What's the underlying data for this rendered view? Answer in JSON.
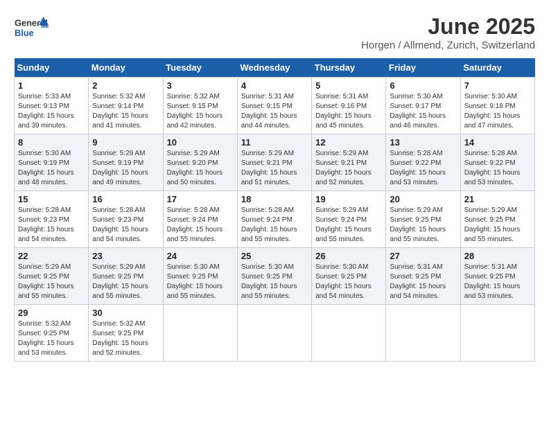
{
  "header": {
    "logo_general": "General",
    "logo_blue": "Blue",
    "title": "June 2025",
    "subtitle": "Horgen / Allmend, Zurich, Switzerland"
  },
  "calendar": {
    "days_of_week": [
      "Sunday",
      "Monday",
      "Tuesday",
      "Wednesday",
      "Thursday",
      "Friday",
      "Saturday"
    ],
    "weeks": [
      [
        null,
        null,
        null,
        null,
        null,
        null,
        null
      ]
    ],
    "cells": [
      [
        null,
        {
          "day": "2",
          "sunrise": "Sunrise: 5:32 AM",
          "sunset": "Sunset: 9:14 PM",
          "daylight": "Daylight: 15 hours and 41 minutes."
        },
        {
          "day": "3",
          "sunrise": "Sunrise: 5:32 AM",
          "sunset": "Sunset: 9:15 PM",
          "daylight": "Daylight: 15 hours and 42 minutes."
        },
        {
          "day": "4",
          "sunrise": "Sunrise: 5:31 AM",
          "sunset": "Sunset: 9:15 PM",
          "daylight": "Daylight: 15 hours and 44 minutes."
        },
        {
          "day": "5",
          "sunrise": "Sunrise: 5:31 AM",
          "sunset": "Sunset: 9:16 PM",
          "daylight": "Daylight: 15 hours and 45 minutes."
        },
        {
          "day": "6",
          "sunrise": "Sunrise: 5:30 AM",
          "sunset": "Sunset: 9:17 PM",
          "daylight": "Daylight: 15 hours and 46 minutes."
        },
        {
          "day": "7",
          "sunrise": "Sunrise: 5:30 AM",
          "sunset": "Sunset: 9:18 PM",
          "daylight": "Daylight: 15 hours and 47 minutes."
        }
      ],
      [
        {
          "day": "1",
          "sunrise": "Sunrise: 5:33 AM",
          "sunset": "Sunset: 9:13 PM",
          "daylight": "Daylight: 15 hours and 39 minutes."
        },
        null,
        null,
        null,
        null,
        null,
        null
      ],
      [
        {
          "day": "8",
          "sunrise": "Sunrise: 5:30 AM",
          "sunset": "Sunset: 9:19 PM",
          "daylight": "Daylight: 15 hours and 48 minutes."
        },
        {
          "day": "9",
          "sunrise": "Sunrise: 5:29 AM",
          "sunset": "Sunset: 9:19 PM",
          "daylight": "Daylight: 15 hours and 49 minutes."
        },
        {
          "day": "10",
          "sunrise": "Sunrise: 5:29 AM",
          "sunset": "Sunset: 9:20 PM",
          "daylight": "Daylight: 15 hours and 50 minutes."
        },
        {
          "day": "11",
          "sunrise": "Sunrise: 5:29 AM",
          "sunset": "Sunset: 9:21 PM",
          "daylight": "Daylight: 15 hours and 51 minutes."
        },
        {
          "day": "12",
          "sunrise": "Sunrise: 5:29 AM",
          "sunset": "Sunset: 9:21 PM",
          "daylight": "Daylight: 15 hours and 52 minutes."
        },
        {
          "day": "13",
          "sunrise": "Sunrise: 5:28 AM",
          "sunset": "Sunset: 9:22 PM",
          "daylight": "Daylight: 15 hours and 53 minutes."
        },
        {
          "day": "14",
          "sunrise": "Sunrise: 5:28 AM",
          "sunset": "Sunset: 9:22 PM",
          "daylight": "Daylight: 15 hours and 53 minutes."
        }
      ],
      [
        {
          "day": "15",
          "sunrise": "Sunrise: 5:28 AM",
          "sunset": "Sunset: 9:23 PM",
          "daylight": "Daylight: 15 hours and 54 minutes."
        },
        {
          "day": "16",
          "sunrise": "Sunrise: 5:28 AM",
          "sunset": "Sunset: 9:23 PM",
          "daylight": "Daylight: 15 hours and 54 minutes."
        },
        {
          "day": "17",
          "sunrise": "Sunrise: 5:28 AM",
          "sunset": "Sunset: 9:24 PM",
          "daylight": "Daylight: 15 hours and 55 minutes."
        },
        {
          "day": "18",
          "sunrise": "Sunrise: 5:28 AM",
          "sunset": "Sunset: 9:24 PM",
          "daylight": "Daylight: 15 hours and 55 minutes."
        },
        {
          "day": "19",
          "sunrise": "Sunrise: 5:29 AM",
          "sunset": "Sunset: 9:24 PM",
          "daylight": "Daylight: 15 hours and 55 minutes."
        },
        {
          "day": "20",
          "sunrise": "Sunrise: 5:29 AM",
          "sunset": "Sunset: 9:25 PM",
          "daylight": "Daylight: 15 hours and 55 minutes."
        },
        {
          "day": "21",
          "sunrise": "Sunrise: 5:29 AM",
          "sunset": "Sunset: 9:25 PM",
          "daylight": "Daylight: 15 hours and 55 minutes."
        }
      ],
      [
        {
          "day": "22",
          "sunrise": "Sunrise: 5:29 AM",
          "sunset": "Sunset: 9:25 PM",
          "daylight": "Daylight: 15 hours and 55 minutes."
        },
        {
          "day": "23",
          "sunrise": "Sunrise: 5:29 AM",
          "sunset": "Sunset: 9:25 PM",
          "daylight": "Daylight: 15 hours and 55 minutes."
        },
        {
          "day": "24",
          "sunrise": "Sunrise: 5:30 AM",
          "sunset": "Sunset: 9:25 PM",
          "daylight": "Daylight: 15 hours and 55 minutes."
        },
        {
          "day": "25",
          "sunrise": "Sunrise: 5:30 AM",
          "sunset": "Sunset: 9:25 PM",
          "daylight": "Daylight: 15 hours and 55 minutes."
        },
        {
          "day": "26",
          "sunrise": "Sunrise: 5:30 AM",
          "sunset": "Sunset: 9:25 PM",
          "daylight": "Daylight: 15 hours and 54 minutes."
        },
        {
          "day": "27",
          "sunrise": "Sunrise: 5:31 AM",
          "sunset": "Sunset: 9:25 PM",
          "daylight": "Daylight: 15 hours and 54 minutes."
        },
        {
          "day": "28",
          "sunrise": "Sunrise: 5:31 AM",
          "sunset": "Sunset: 9:25 PM",
          "daylight": "Daylight: 15 hours and 53 minutes."
        }
      ],
      [
        {
          "day": "29",
          "sunrise": "Sunrise: 5:32 AM",
          "sunset": "Sunset: 9:25 PM",
          "daylight": "Daylight: 15 hours and 53 minutes."
        },
        {
          "day": "30",
          "sunrise": "Sunrise: 5:32 AM",
          "sunset": "Sunset: 9:25 PM",
          "daylight": "Daylight: 15 hours and 52 minutes."
        },
        null,
        null,
        null,
        null,
        null
      ]
    ]
  }
}
